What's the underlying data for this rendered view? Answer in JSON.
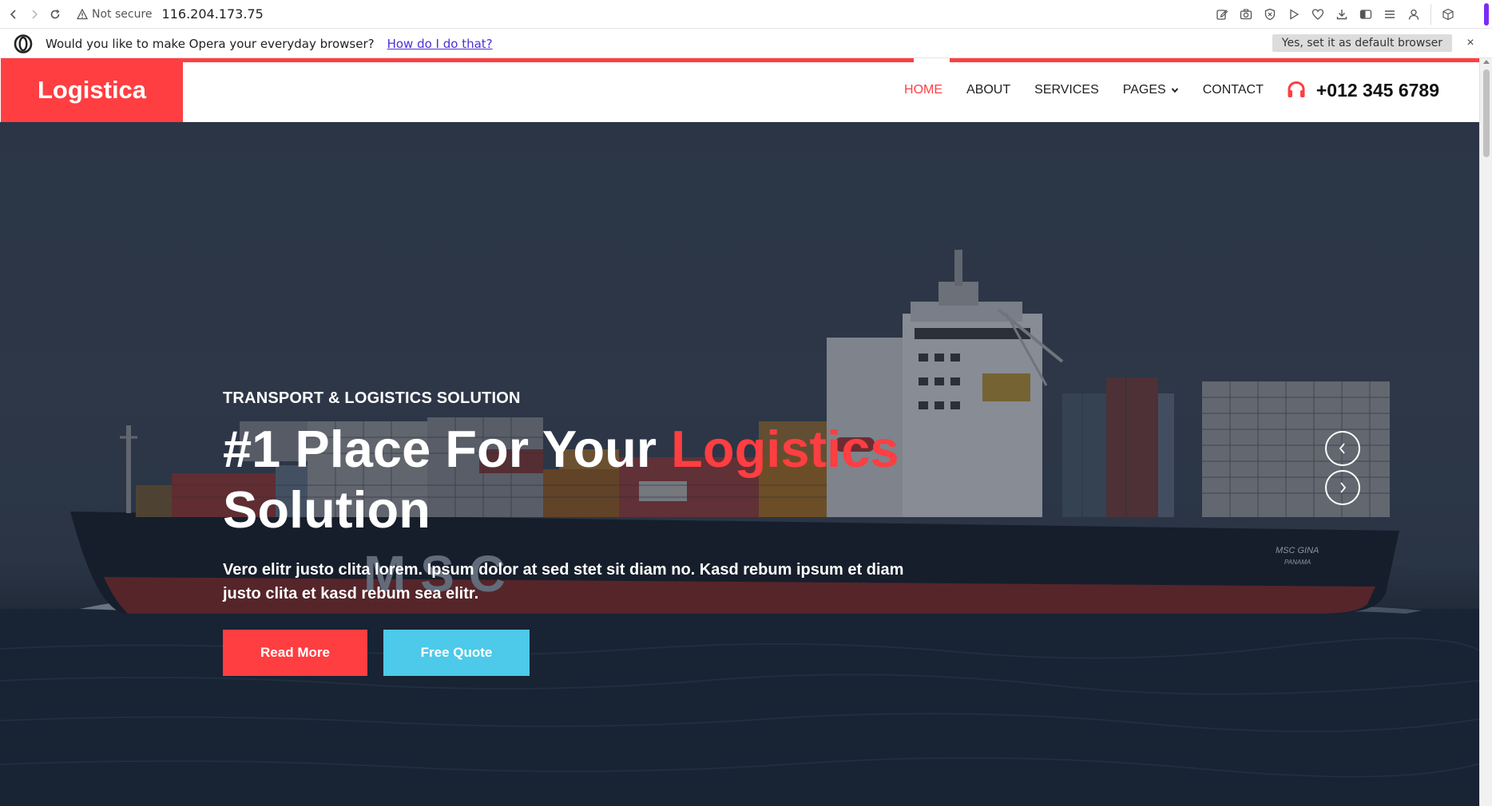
{
  "browser": {
    "not_secure": "Not secure",
    "url": "116.204.173.75"
  },
  "opera_bar": {
    "question": "Would you like to make Opera your everyday browser?",
    "link": "How do I do that?",
    "default_button": "Yes, set it as default browser",
    "close": "×"
  },
  "nav": {
    "brand": "Logistica",
    "items": [
      {
        "label": "HOME",
        "active": true
      },
      {
        "label": "ABOUT"
      },
      {
        "label": "SERVICES"
      },
      {
        "label": "PAGES"
      },
      {
        "label": "CONTACT"
      }
    ],
    "phone": "+012 345 6789"
  },
  "hero": {
    "tag": "TRANSPORT & LOGISTICS SOLUTION",
    "title_before": "#1 Place For Your ",
    "title_accent": "Logistics",
    "title_after": "Solution",
    "description": "Vero elitr justo clita lorem. Ipsum dolor at sed stet sit diam no. Kasd rebum ipsum et diam justo clita et kasd rebum sea elitr.",
    "read_more": "Read More",
    "free_quote": "Free Quote",
    "ship_name": "MSC GINA",
    "ship_port": "PANAMA",
    "hull_letters": "MSC"
  },
  "colors": {
    "accent": "#ff3e41",
    "secondary": "#4dc9e9"
  }
}
